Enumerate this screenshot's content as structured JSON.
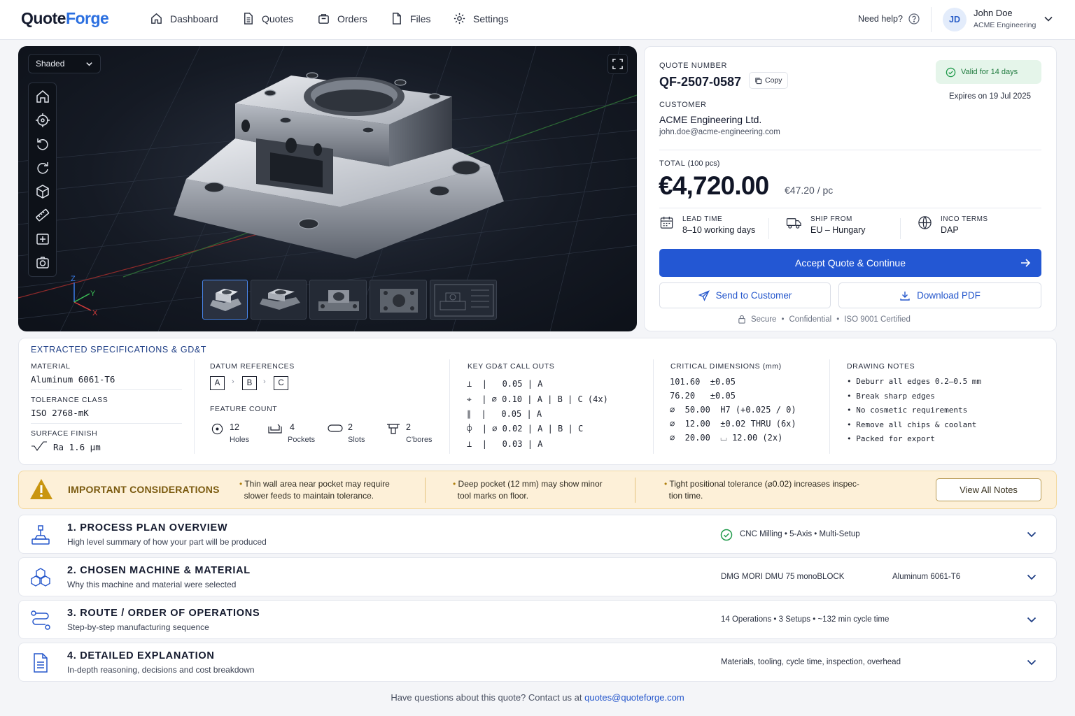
{
  "app": {
    "logo_part1": "Quote",
    "logo_part2": "Forge"
  },
  "nav": {
    "items": [
      {
        "label": "Dashboard",
        "icon": "home-icon"
      },
      {
        "label": "Quotes",
        "icon": "document-icon"
      },
      {
        "label": "Orders",
        "icon": "box-icon"
      },
      {
        "label": "Files",
        "icon": "file-icon"
      },
      {
        "label": "Settings",
        "icon": "gear-icon"
      }
    ],
    "help": "Need help?",
    "user": {
      "initials": "JD",
      "name": "John Doe",
      "org": "ACME Engineering"
    }
  },
  "viewer": {
    "mode": "Shaded",
    "axes": {
      "x": "X",
      "y": "Y",
      "z": "Z"
    },
    "tools": [
      "home-icon",
      "crosshair-icon",
      "undo-rotate-icon",
      "rotate-icon",
      "cube-icon",
      "ruler-icon",
      "section-view-icon",
      "camera-icon"
    ],
    "thumbnail_count": 5,
    "selected_thumbnail": 1
  },
  "quote": {
    "number_label": "QUOTE NUMBER",
    "number": "QF-2507-0587",
    "copy": "Copy",
    "valid": "Valid for 14 days",
    "expires": "Expires on 19 Jul 2025",
    "customer_label": "CUSTOMER",
    "customer": "ACME Engineering Ltd.",
    "email": "john.doe@acme-engineering.com",
    "total_label": "TOTAL",
    "total_qty": "(100 pcs)",
    "total": "€4,720.00",
    "per_pc": "€47.20 / pc",
    "lead_label": "LEAD TIME",
    "lead": "8–10 working days",
    "ship_label": "SHIP FROM",
    "ship": "EU – Hungary",
    "inco_label": "INCO TERMS",
    "inco": "DAP",
    "accept": "Accept Quote & Continue",
    "send": "Send to Customer",
    "download": "Download PDF",
    "trust": [
      "Secure",
      "Confidential",
      "ISO 9001 Certified"
    ]
  },
  "specs": {
    "title": "EXTRACTED SPECIFICATIONS & GD&T",
    "material_label": "MATERIAL",
    "material": "Aluminum 6061-T6",
    "tolerance_label": "TOLERANCE CLASS",
    "tolerance": "ISO 2768-mK",
    "finish_label": "SURFACE FINISH",
    "finish": "Ra 1.6 µm",
    "datum_label": "DATUM REFERENCES",
    "datums": [
      "A",
      "B",
      "C"
    ],
    "feature_label": "FEATURE COUNT",
    "features": [
      {
        "count": "12",
        "label": "Holes"
      },
      {
        "count": "4",
        "label": "Pockets"
      },
      {
        "count": "2",
        "label": "Slots"
      },
      {
        "count": "2",
        "label": "C'bores"
      }
    ],
    "gdt_label": "KEY GD&T CALL OUTS",
    "gdt": [
      {
        "sym": "⊥",
        "line": "|   0.05 | A"
      },
      {
        "sym": "⌖",
        "line": "| ∅ 0.10 | A | B | C (4x)"
      },
      {
        "sym": "∥",
        "line": "|   0.05 | A"
      },
      {
        "sym": "⌽",
        "line": "| ∅ 0.02 | A | B | C"
      },
      {
        "sym": "⊥",
        "line": "|   0.03 | A"
      }
    ],
    "dims_label": "CRITICAL DIMENSIONS (mm)",
    "dims": [
      "101.60  ±0.05",
      "76.20   ±0.05",
      "∅  50.00  H7 (+0.025 / 0)",
      "∅  12.00  ±0.02 THRU (6x)",
      "∅  20.00  ⌴ 12.00 (2x)"
    ],
    "notes_label": "DRAWING NOTES",
    "notes": [
      "• Deburr all edges 0.2–0.5 mm",
      "• Break sharp edges",
      "• No cosmetic requirements",
      "• Remove all chips & coolant",
      "• Packed for export"
    ]
  },
  "warning": {
    "title": "IMPORTANT CONSIDERATIONS",
    "p1a": "Thin wall area near pocket may require",
    "p1b": "slower feeds to maintain tolerance.",
    "p2a": "Deep pocket (12 mm) may show minor",
    "p2b": "tool marks on floor.",
    "p3a": "Tight positional tolerance (⌀0.02) increases inspec-",
    "p3b": "tion time.",
    "button": "View All Notes"
  },
  "sections": [
    {
      "title": "1.  PROCESS PLAN OVERVIEW",
      "subtitle": "High level summary of how your part will be produced",
      "meta": "CNC Milling  •  5-Axis  •  Multi-Setup"
    },
    {
      "title": "2.  CHOSEN MACHINE & MATERIAL",
      "subtitle": "Why this machine and material were selected",
      "meta_a": "DMG MORI DMU 75 monoBLOCK",
      "meta_b": "Aluminum 6061-T6"
    },
    {
      "title": "3.  ROUTE / ORDER OF OPERATIONS",
      "subtitle": "Step-by-step manufacturing sequence",
      "meta": "14 Operations  •  3 Setups  •  ~132 min cycle time"
    },
    {
      "title": "4.  DETAILED EXPLANATION",
      "subtitle": "In-depth reasoning, decisions and cost breakdown",
      "meta": "Materials, tooling, cycle time, inspection, overhead"
    }
  ],
  "footer": {
    "text": "Have questions about this quote?  Contact us at ",
    "email": "quotes@quoteforge.com"
  },
  "colors": {
    "primary": "#2357d3",
    "accent": "#2b6fe0",
    "valid_green": "#1f7a3e",
    "warning_bg": "#fdf0d8",
    "warning_icon": "#c9950f"
  }
}
